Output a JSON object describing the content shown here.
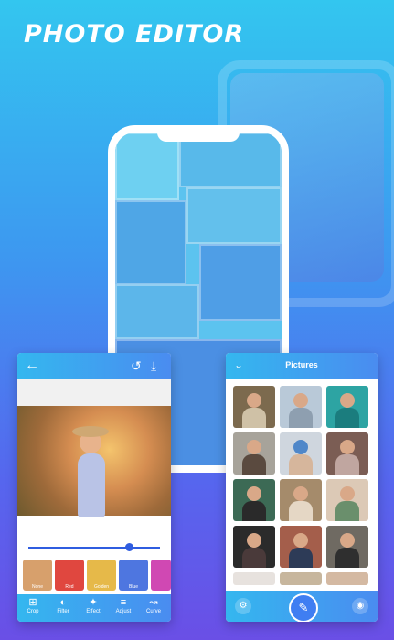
{
  "header": {
    "title": "PHOTO EDITOR"
  },
  "editor": {
    "back_icon": "arrow-left-icon",
    "toolbar_icons": [
      "history-icon",
      "download-icon"
    ],
    "filters": [
      {
        "label": "None",
        "color": "#d7a06c"
      },
      {
        "label": "Red",
        "color": "#e0473f"
      },
      {
        "label": "Golden",
        "color": "#e6b949"
      },
      {
        "label": "Blue",
        "color": "#4e76e0"
      },
      {
        "label": "",
        "color": "#d048b3"
      }
    ],
    "tools": [
      {
        "label": "Crop",
        "icon": "crop-icon"
      },
      {
        "label": "Filter",
        "icon": "filter-icon"
      },
      {
        "label": "Effect",
        "icon": "magic-wand-icon"
      },
      {
        "label": "Adjust",
        "icon": "sliders-icon"
      },
      {
        "label": "Curve",
        "icon": "curve-chart-icon"
      }
    ],
    "slider_level": 0.8
  },
  "pictures": {
    "title": "Pictures",
    "back_icon": "chevron-down-icon",
    "bottom_icons": [
      "settings-icon",
      "pencil-icon",
      "camera-icon"
    ],
    "cell_colors": [
      "#7c6a4e",
      "#b9c9d8",
      "#2da4a3",
      "#a7a39a",
      "#cfd6de",
      "#7b5d54",
      "#3c6a55",
      "#a58b6b",
      "#dcc9b6",
      "#2b2b2b",
      "#a45e4b",
      "#6f6a62",
      "#e7e2de",
      "#c7b69d",
      "#d4b9a2"
    ]
  }
}
